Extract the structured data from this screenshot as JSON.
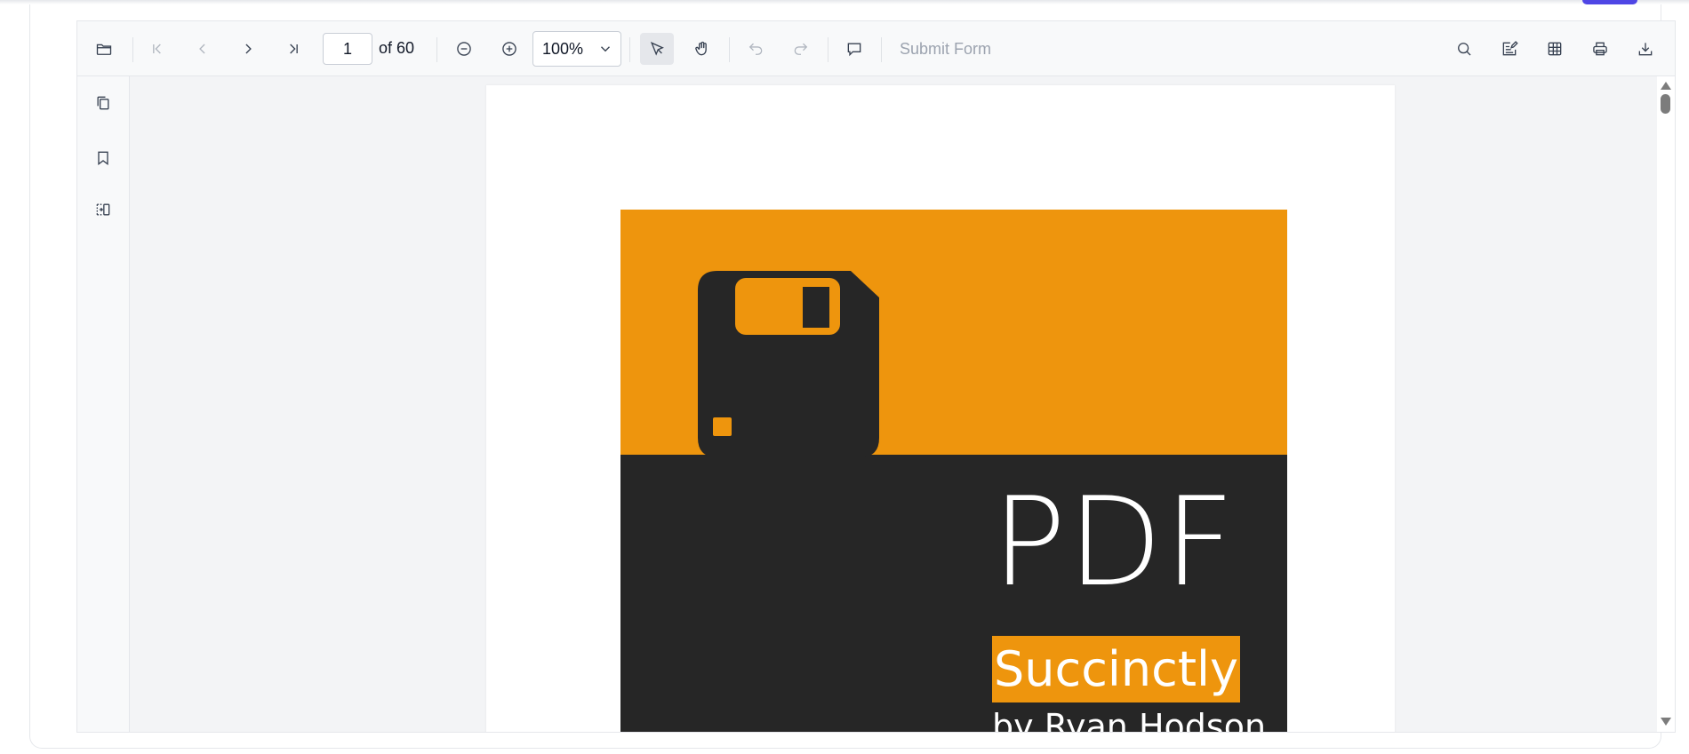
{
  "toolbar": {
    "page_number": "1",
    "page_count_text": "of 60",
    "zoom_value": "100%",
    "submit_form_label": "Submit Form",
    "icons": {
      "open": "folder-icon",
      "first_page": "first-page-icon",
      "previous_page": "chevron-left-icon",
      "next_page": "chevron-right-icon",
      "last_page": "last-page-icon",
      "zoom_out": "zoom-out-icon",
      "zoom_in": "zoom-in-icon",
      "text_select": "cursor-arrow-icon",
      "pan": "hand-icon",
      "undo": "undo-icon",
      "redo": "redo-icon",
      "comment": "comment-icon",
      "search": "search-icon",
      "annotation": "annotation-icon",
      "form_designer": "form-grid-icon",
      "print": "printer-icon",
      "download": "download-icon"
    }
  },
  "sidebar": {
    "icons": [
      "page-thumbnails-icon",
      "bookmark-icon",
      "organize-pages-icon"
    ]
  },
  "document": {
    "cover": {
      "title": "PDF",
      "badge": "Succinctly",
      "author": "by Ryan Hodson",
      "accent_color": "#ee950d",
      "dark_color": "#262626",
      "logo_icon": "floppy-disk-icon"
    }
  },
  "theme": {
    "toolbar_bg": "#f8f9fa",
    "canvas_bg": "#f3f4f6",
    "brand_pill": "#4f46e5"
  }
}
